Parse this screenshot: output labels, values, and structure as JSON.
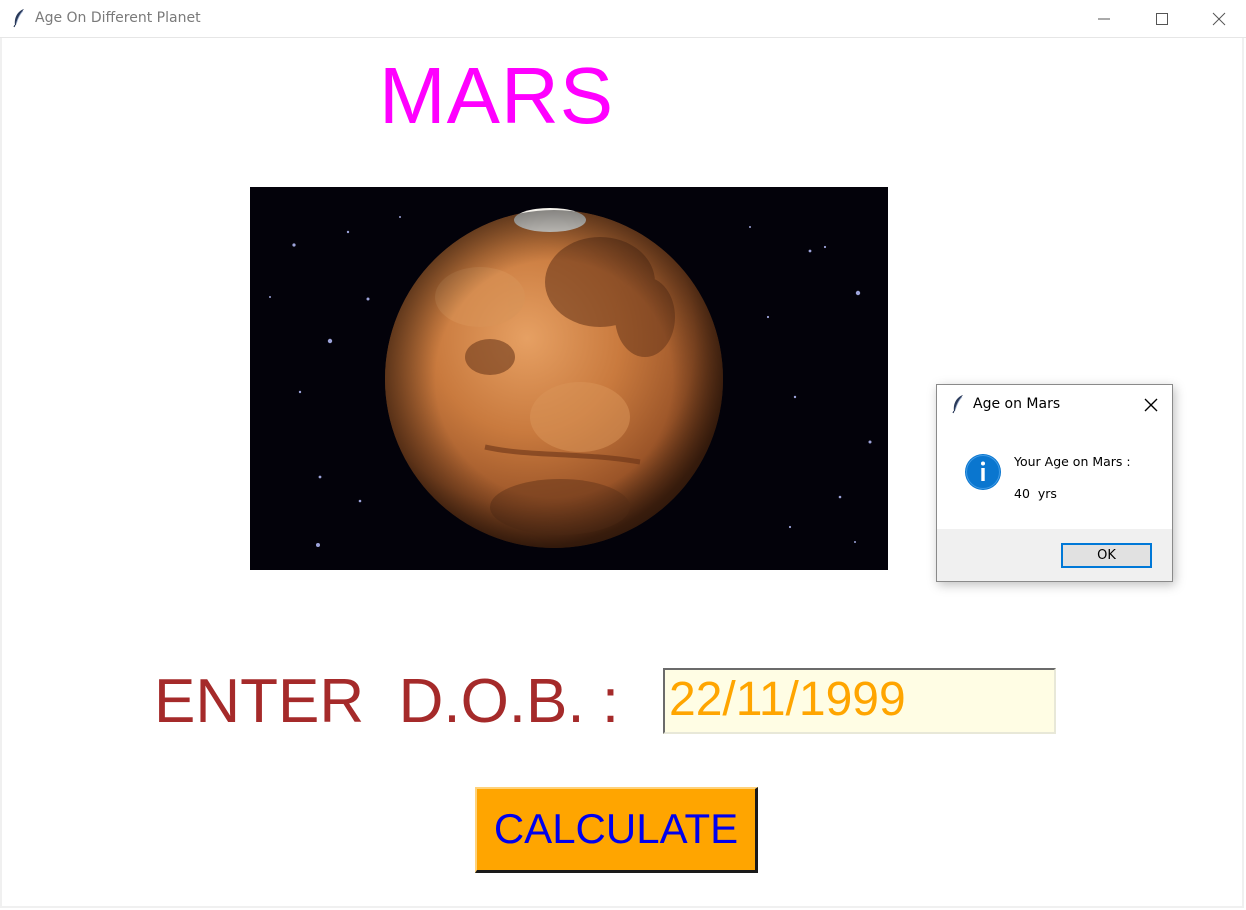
{
  "window": {
    "title": "Age On Different Planet",
    "icon": "feather-icon"
  },
  "main": {
    "planet_title": "MARS",
    "planet_image": "mars-planet-image",
    "dob_label": "ENTER  D.O.B. :",
    "dob_value": "22/11/1999",
    "calculate_label": "CALCULATE"
  },
  "dialog": {
    "title": "Age on Mars",
    "icon": "info-icon",
    "message_line1": "Your Age on Mars :",
    "message_line2": "40  yrs",
    "ok_label": "OK"
  },
  "colors": {
    "planet_title": "#ff00ff",
    "dob_label": "#a52a2a",
    "dob_text": "#ffa500",
    "dob_bg": "#fffde4",
    "button_bg": "#ffa500",
    "button_text": "#0000ee",
    "info_icon": "#0078d7"
  }
}
